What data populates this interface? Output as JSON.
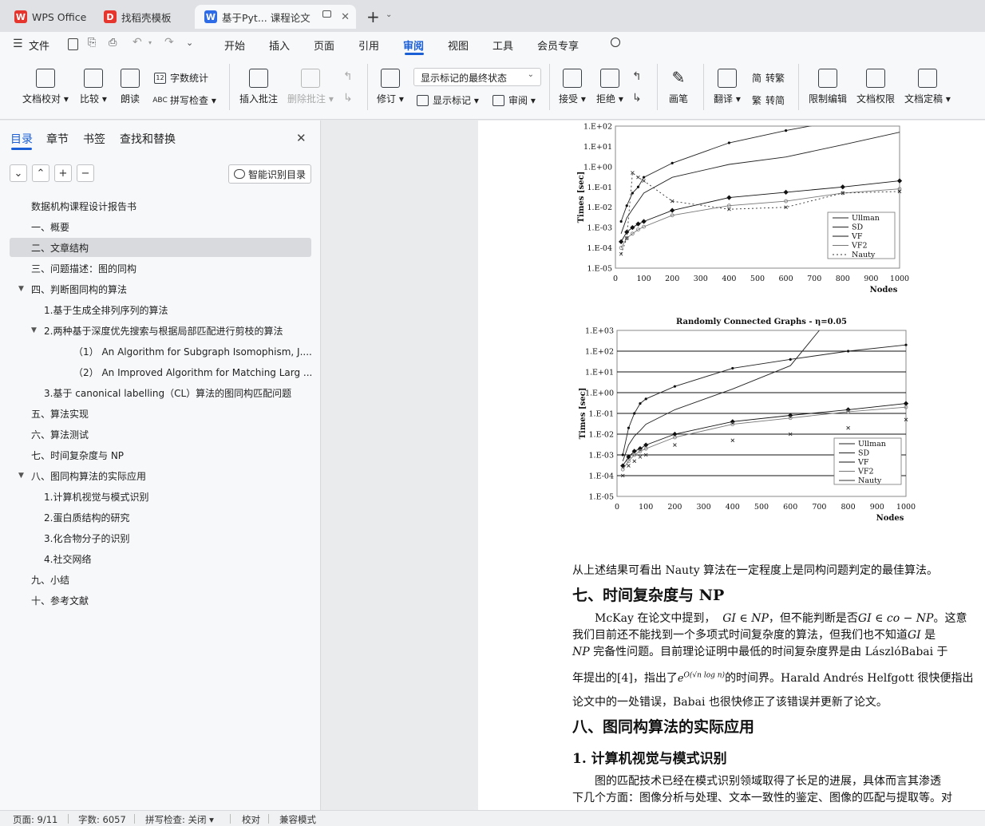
{
  "tabs": [
    {
      "label": "WPS Office",
      "icon": "wps-logo-icon"
    },
    {
      "label": "找稻壳模板",
      "icon": "docer-icon"
    },
    {
      "label": "基于Pyt... 课程论文",
      "icon": "writer-doc-icon"
    }
  ],
  "menu": {
    "file": "文件",
    "items": [
      "开始",
      "插入",
      "页面",
      "引用",
      "审阅",
      "视图",
      "工具",
      "会员专享"
    ],
    "active": "审阅"
  },
  "ribbon": {
    "doc_check": "文档校对",
    "compare": "比较",
    "read_aloud": "朗读",
    "word_count": "字数统计",
    "spell_check": "拼写检查",
    "insert_comment": "插入批注",
    "delete_comment": "删除批注",
    "revise": "修订",
    "markup_display": "显示标记的最终状态",
    "show_markup": "显示标记",
    "review_pane": "审阅",
    "accept": "接受",
    "reject": "拒绝",
    "pen": "画笔",
    "translate": "翻译",
    "to_traditional": "转繁",
    "to_simplified": "转简",
    "restrict_edit": "限制编辑",
    "doc_permission": "文档权限",
    "doc_finalize": "文档定稿"
  },
  "nav": {
    "tabs": [
      "目录",
      "章节",
      "书签",
      "查找和替换"
    ],
    "smart_toc": "智能识别目录",
    "toc": [
      {
        "label": "数据机构课程设计报告书",
        "level": 0,
        "arrow": ""
      },
      {
        "label": "一、概要",
        "level": 0,
        "arrow": ""
      },
      {
        "label": "二、文章结构",
        "level": 0,
        "arrow": "",
        "selected": true
      },
      {
        "label": "三、问题描述：图的同构",
        "level": 0,
        "arrow": ""
      },
      {
        "label": "四、判断图同构的算法",
        "level": 0,
        "arrow": "▼"
      },
      {
        "label": "1.基于生成全排列序列的算法",
        "level": 1,
        "arrow": ""
      },
      {
        "label": "2.两种基于深度优先搜索与根据局部匹配进行剪枝的算法",
        "level": 1,
        "arrow": "▼"
      },
      {
        "label": "（1）  An Algorithm for Subgraph Isomophism, J....",
        "level": 2,
        "arrow": ""
      },
      {
        "label": "（2）  An Improved Algorithm for Matching Larg ...",
        "level": 2,
        "arrow": ""
      },
      {
        "label": "3.基于 canonical labelling（CL）算法的图同构匹配问题",
        "level": 1,
        "arrow": ""
      },
      {
        "label": "五、算法实现",
        "level": 0,
        "arrow": ""
      },
      {
        "label": "六、算法测试",
        "level": 0,
        "arrow": ""
      },
      {
        "label": "七、时间复杂度与 NP",
        "level": 0,
        "arrow": ""
      },
      {
        "label": "八、图同构算法的实际应用",
        "level": 0,
        "arrow": "▼"
      },
      {
        "label": "1.计算机视觉与模式识别",
        "level": 1,
        "arrow": ""
      },
      {
        "label": "2.蛋白质结构的研究",
        "level": 1,
        "arrow": ""
      },
      {
        "label": "3.化合物分子的识别",
        "level": 1,
        "arrow": ""
      },
      {
        "label": "4.社交网络",
        "level": 1,
        "arrow": ""
      },
      {
        "label": "九、小结",
        "level": 0,
        "arrow": ""
      },
      {
        "label": "十、参考文献",
        "level": 0,
        "arrow": ""
      }
    ]
  },
  "chart_data": [
    {
      "type": "line",
      "title": "",
      "xlabel": "Nodes",
      "ylabel": "Times [sec]",
      "yscale": "log",
      "x_ticks": [
        "0",
        "100",
        "200",
        "300",
        "400",
        "500",
        "600",
        "700",
        "800",
        "900",
        "1000"
      ],
      "y_ticks": [
        "1.E+02",
        "1.E+01",
        "1.E+00",
        "1.E-01",
        "1.E-02",
        "1.E-03",
        "1.E-04",
        "1.E-05"
      ],
      "legend_position": "bottom-right",
      "series": [
        {
          "name": "Ullman",
          "x": [
            20,
            40,
            60,
            80,
            100,
            200,
            400,
            600,
            800,
            1000
          ],
          "y": [
            0.002,
            0.012,
            0.05,
            0.1,
            0.3,
            1.5,
            15,
            60,
            200,
            400
          ]
        },
        {
          "name": "SD",
          "x": [
            20,
            40,
            60,
            80,
            100,
            200,
            400,
            600,
            800,
            1000
          ],
          "y": [
            0.0005,
            0.003,
            0.008,
            0.02,
            0.05,
            0.3,
            1.3,
            3,
            12,
            50
          ]
        },
        {
          "name": "VF",
          "x": [
            20,
            40,
            60,
            80,
            100,
            200,
            400,
            600,
            800,
            1000
          ],
          "y": [
            0.0002,
            0.0006,
            0.001,
            0.0015,
            0.002,
            0.007,
            0.03,
            0.055,
            0.1,
            0.2
          ]
        },
        {
          "name": "VF2",
          "x": [
            20,
            40,
            60,
            80,
            100,
            200,
            400,
            600,
            800,
            1000
          ],
          "y": [
            0.0001,
            0.0003,
            0.0005,
            0.0008,
            0.0011,
            0.004,
            0.012,
            0.02,
            0.05,
            0.08
          ]
        },
        {
          "name": "Nauty",
          "x": [
            20,
            40,
            60,
            80,
            100,
            200,
            400,
            600,
            800,
            1000
          ],
          "y": [
            5e-05,
            0.0003,
            0.5,
            0.3,
            0.2,
            0.02,
            0.008,
            0.01,
            0.05,
            0.06
          ]
        }
      ]
    },
    {
      "type": "line",
      "title": "Randomly Connected Graphs - η=0.05",
      "xlabel": "Nodes",
      "ylabel": "Times [sec]",
      "yscale": "log",
      "x_ticks": [
        "0",
        "100",
        "200",
        "300",
        "400",
        "500",
        "600",
        "700",
        "800",
        "900",
        "1000"
      ],
      "y_ticks": [
        "1.E+03",
        "1.E+02",
        "1.E+01",
        "1.E+00",
        "1.E-01",
        "1.E-02",
        "1.E-03",
        "1.E-04",
        "1.E-05"
      ],
      "legend_position": "bottom-right",
      "series": [
        {
          "name": "Ullman",
          "x": [
            20,
            40,
            60,
            80,
            100,
            200,
            400,
            600,
            800,
            1000
          ],
          "y": [
            0.001,
            0.02,
            0.1,
            0.3,
            0.5,
            2,
            15,
            40,
            100,
            200
          ]
        },
        {
          "name": "SD",
          "x": [
            20,
            40,
            60,
            80,
            100,
            200,
            400,
            600,
            700
          ],
          "y": [
            0.0005,
            0.003,
            0.008,
            0.015,
            0.03,
            0.15,
            1.5,
            20,
            1000
          ]
        },
        {
          "name": "VF",
          "x": [
            20,
            40,
            60,
            80,
            100,
            200,
            400,
            600,
            800,
            1000
          ],
          "y": [
            0.0003,
            0.0008,
            0.0015,
            0.002,
            0.003,
            0.01,
            0.04,
            0.08,
            0.15,
            0.3
          ]
        },
        {
          "name": "VF2",
          "x": [
            20,
            40,
            60,
            80,
            100,
            200,
            400,
            600,
            800,
            1000
          ],
          "y": [
            0.0002,
            0.0005,
            0.001,
            0.0015,
            0.002,
            0.007,
            0.03,
            0.06,
            0.12,
            0.2
          ]
        },
        {
          "name": "Nauty",
          "x": [
            20,
            40,
            60,
            80,
            100,
            200,
            400,
            600,
            800,
            1000
          ],
          "y": [
            0.0001,
            0.0003,
            0.0005,
            0.0008,
            0.001,
            0.003,
            0.005,
            0.01,
            0.02,
            0.05
          ]
        }
      ]
    }
  ],
  "doc": {
    "conclusion": "从上述结果可看出  Nauty 算法在一定程度上是同构问题判定的最佳算法。",
    "h_complexity": "七、时间复杂度与 NP",
    "p1_line1_a": "McKay  在论文中提到，",
    "p1_line1_b": "GI ∈ NP",
    "p1_line1_c": "，但不能判断是否",
    "p1_line1_d": "GI ∈ co − NP",
    "p1_line1_e": "。这意",
    "p1_line2_a": "我们目前还不能找到一个多项式时间复杂度的算法，但我们也不知道",
    "p1_line2_b": "GI",
    "p1_line2_c": " 是",
    "p1_line3_a": "NP",
    "p1_line3_b": " 完备性问题。目前理论证明中最低的时间复杂度界是由  LászlóBabai  于",
    "p1_line4_a": "年提出的[4]，指出了",
    "p1_line4_formula": "e^{O(√(n log n))}",
    "p1_line4_b": "的时间界。Harald Andrés Helfgott 很快便指出",
    "p1_line5": "论文中的一处错误，Babai 也很快修正了该错误并更新了论文。",
    "h_apps": "八、图同构算法的实际应用",
    "h_cv": "1. 计算机视觉与模式识别",
    "p2_line1": "图的匹配技术已经在模式识别领域取得了长足的进展，具体而言其渗透",
    "p2_line2": "下几个方面：图像分析与处理、文本一致性的鉴定、图像的匹配与提取等。对"
  },
  "status": {
    "page": "页面: 9/11",
    "words": "字数: 6057",
    "spell": "拼写检查: 关闭",
    "proof": "校对",
    "compat": "兼容模式"
  }
}
